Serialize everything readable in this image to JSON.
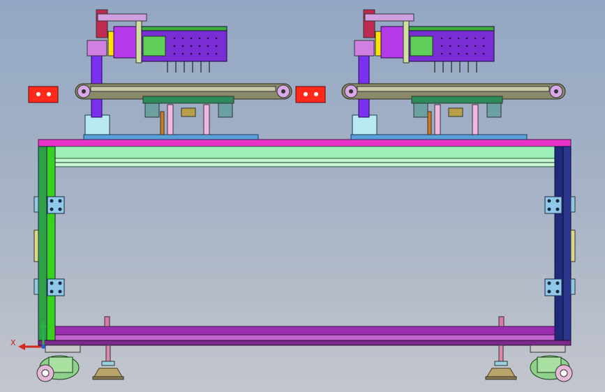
{
  "viewport": {
    "background_top": "#93a7c4",
    "background_bottom": "#c3c6cd"
  },
  "triad": {
    "x_axis_label": "X",
    "x_axis_color": "#d42a22",
    "y_axis_color": "#2fb04a"
  },
  "colors": {
    "frame_top_rail": "#e832c8",
    "frame_left_leg": "#38d11f",
    "frame_right_leg": "#1f2a7a",
    "frame_bottom_rail": "#9a2eb0",
    "crossbar": "#9ff0b8",
    "conveyor_belt": "#8a8a6a",
    "gripper_housing": "#7a2dd4",
    "column": "#7b2ff0",
    "motor_block": "#ff2a1a",
    "leveling_foot": "#b9a46a",
    "caster": "#8fd08a"
  },
  "icons": {
    "axis_triad": "xyz-triad-icon",
    "left_motor": "motor-block-icon",
    "right_motor": "motor-block-icon"
  }
}
